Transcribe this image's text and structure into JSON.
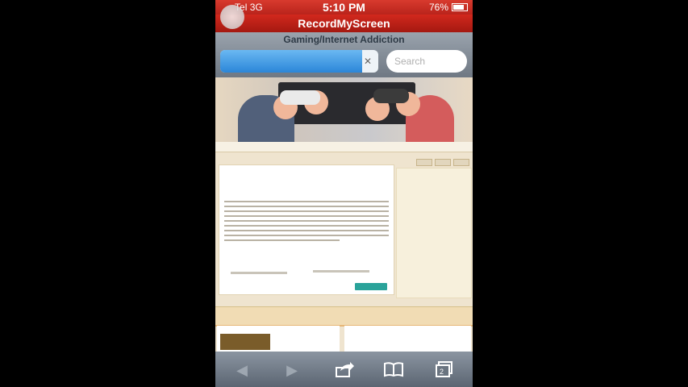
{
  "status_bar": {
    "carrier": "Tel",
    "network": "3G",
    "time": "5:10 PM",
    "battery": "76%"
  },
  "recording_banner": {
    "title": "RecordMyScreen"
  },
  "browser": {
    "page_title": "Gaming/Internet Addiction",
    "search_placeholder": "Search",
    "load_progress": 0.9
  },
  "toolbar": {
    "back_icon": "back-arrow-icon",
    "forward_icon": "forward-arrow-icon",
    "share_icon": "share-icon",
    "bookmarks_icon": "bookmarks-icon",
    "tabs_icon": "tabs-icon",
    "tabs_count": "2"
  }
}
